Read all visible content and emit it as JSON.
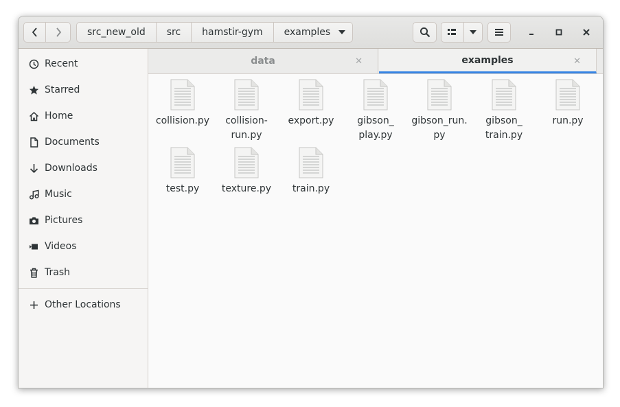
{
  "header": {
    "breadcrumbs": [
      "src_new_old",
      "src",
      "hamstir-gym",
      "examples"
    ]
  },
  "sidebar": {
    "items": [
      {
        "label": "Recent",
        "icon": "clock-icon"
      },
      {
        "label": "Starred",
        "icon": "star-icon"
      },
      {
        "label": "Home",
        "icon": "home-icon"
      },
      {
        "label": "Documents",
        "icon": "document-icon"
      },
      {
        "label": "Downloads",
        "icon": "download-icon"
      },
      {
        "label": "Music",
        "icon": "music-icon"
      },
      {
        "label": "Pictures",
        "icon": "camera-icon"
      },
      {
        "label": "Videos",
        "icon": "video-icon"
      },
      {
        "label": "Trash",
        "icon": "trash-icon"
      }
    ],
    "other_locations": "Other Locations"
  },
  "tabs": [
    {
      "label": "data",
      "active": false
    },
    {
      "label": "examples",
      "active": true
    }
  ],
  "files": [
    {
      "name": "collision.py"
    },
    {
      "name": "collision-\nrun.py"
    },
    {
      "name": "export.py"
    },
    {
      "name": "gibson_\nplay.py"
    },
    {
      "name": "gibson_run.\npy"
    },
    {
      "name": "gibson_\ntrain.py"
    },
    {
      "name": "run.py"
    },
    {
      "name": "test.py"
    },
    {
      "name": "texture.py"
    },
    {
      "name": "train.py"
    }
  ],
  "colors": {
    "accent": "#3584e4",
    "text": "#2e3436",
    "sidebar_bg": "#f6f5f4"
  }
}
